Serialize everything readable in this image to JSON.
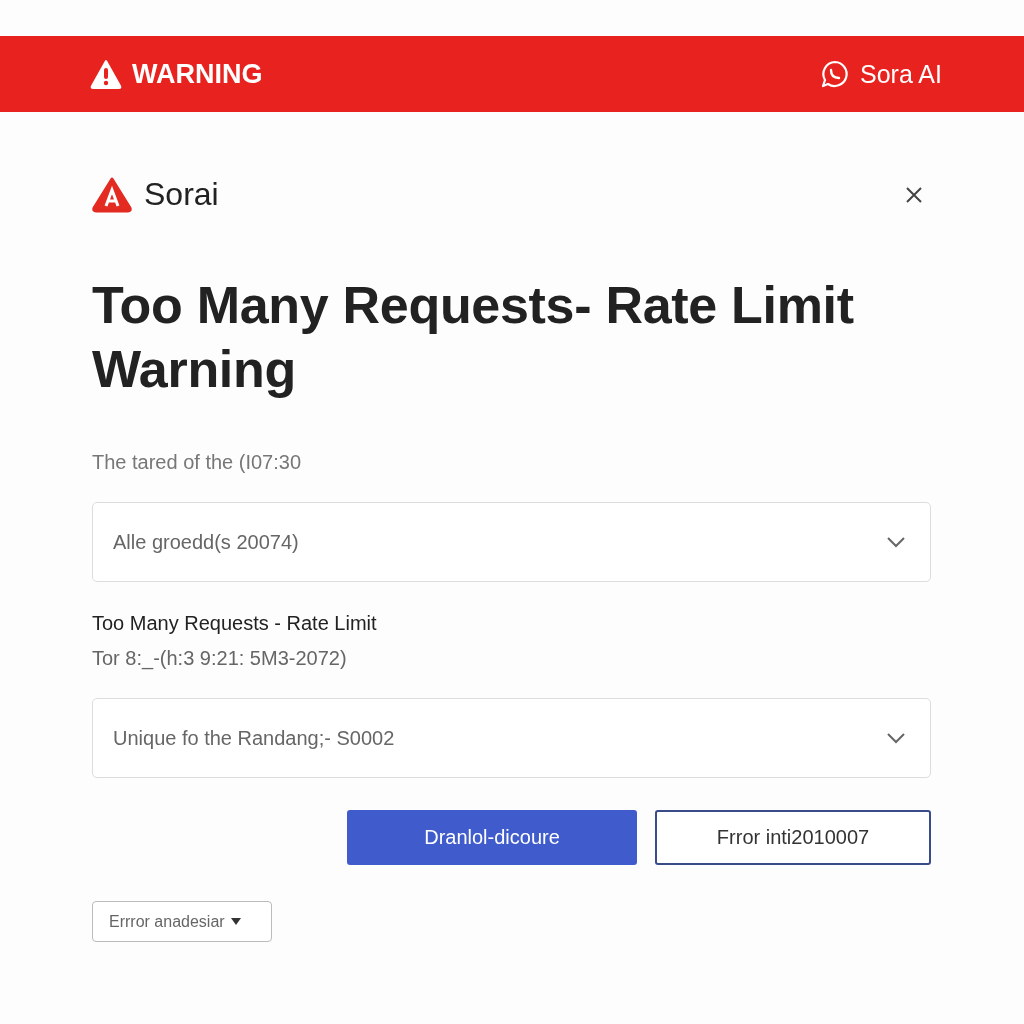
{
  "banner": {
    "title": "WARNING",
    "brand": "Sora AI"
  },
  "dialog": {
    "app_name": "Sorai",
    "heading": "Too Many Requests- Rate Limit Warning",
    "subtitle": "The tared of the (I07:30",
    "selects": [
      {
        "value": "Alle groedd(s 20074)",
        "label": "Too Many Requests - Rate Limit",
        "hint": "Tor 8:_-(h:3 9:21: 5M3-2072)"
      },
      {
        "value": "Unique fo the Randang;- S0002"
      }
    ],
    "buttons": [
      {
        "label": "Dranlol-dicoure",
        "kind": "primary"
      },
      {
        "label": "Frror inti2010007",
        "kind": "secondary"
      }
    ],
    "menu_button": {
      "label": "Errror anadesiar"
    }
  }
}
